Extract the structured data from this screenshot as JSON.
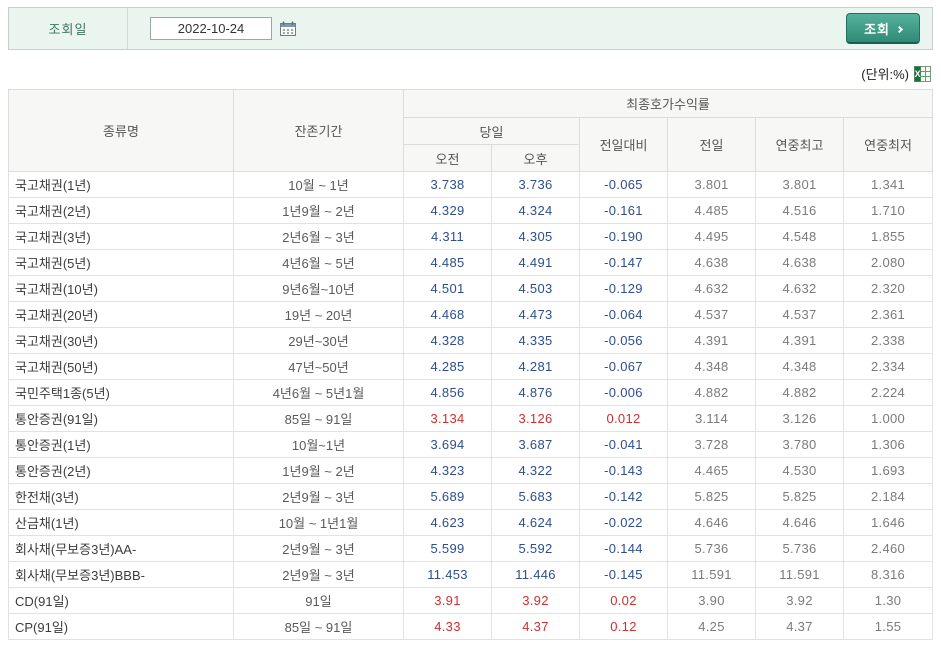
{
  "query_bar": {
    "label": "조회일",
    "date_value": "2022-10-24",
    "search_button": "조회"
  },
  "unit_label": "(단위:%)",
  "colors": {
    "accent_teal": "#2f8b76",
    "negative_blue": "#2e4e8f",
    "positive_red": "#cc2f2f",
    "bar_bg": "#eaf5f0"
  },
  "table": {
    "headers": {
      "col_type": "종류명",
      "col_period": "잔존기간",
      "group_yield": "최종호가수익률",
      "group_today": "당일",
      "col_morning": "오전",
      "col_afternoon": "오후",
      "col_change": "전일대비",
      "col_prev": "전일",
      "col_high": "연중최고",
      "col_low": "연중최저"
    },
    "rows": [
      {
        "name": "국고채권(1년)",
        "period": "10월 ~ 1년",
        "am": "3.738",
        "pm": "3.736",
        "change": "-0.065",
        "prev": "3.801",
        "high": "3.801",
        "low": "1.341",
        "up": false
      },
      {
        "name": "국고채권(2년)",
        "period": "1년9월 ~ 2년",
        "am": "4.329",
        "pm": "4.324",
        "change": "-0.161",
        "prev": "4.485",
        "high": "4.516",
        "low": "1.710",
        "up": false
      },
      {
        "name": "국고채권(3년)",
        "period": "2년6월 ~ 3년",
        "am": "4.311",
        "pm": "4.305",
        "change": "-0.190",
        "prev": "4.495",
        "high": "4.548",
        "low": "1.855",
        "up": false
      },
      {
        "name": "국고채권(5년)",
        "period": "4년6월 ~ 5년",
        "am": "4.485",
        "pm": "4.491",
        "change": "-0.147",
        "prev": "4.638",
        "high": "4.638",
        "low": "2.080",
        "up": false
      },
      {
        "name": "국고채권(10년)",
        "period": "9년6월~10년",
        "am": "4.501",
        "pm": "4.503",
        "change": "-0.129",
        "prev": "4.632",
        "high": "4.632",
        "low": "2.320",
        "up": false
      },
      {
        "name": "국고채권(20년)",
        "period": "19년 ~ 20년",
        "am": "4.468",
        "pm": "4.473",
        "change": "-0.064",
        "prev": "4.537",
        "high": "4.537",
        "low": "2.361",
        "up": false
      },
      {
        "name": "국고채권(30년)",
        "period": "29년~30년",
        "am": "4.328",
        "pm": "4.335",
        "change": "-0.056",
        "prev": "4.391",
        "high": "4.391",
        "low": "2.338",
        "up": false
      },
      {
        "name": "국고채권(50년)",
        "period": "47년~50년",
        "am": "4.285",
        "pm": "4.281",
        "change": "-0.067",
        "prev": "4.348",
        "high": "4.348",
        "low": "2.334",
        "up": false
      },
      {
        "name": "국민주택1종(5년)",
        "period": "4년6월 ~ 5년1월",
        "am": "4.856",
        "pm": "4.876",
        "change": "-0.006",
        "prev": "4.882",
        "high": "4.882",
        "low": "2.224",
        "up": false
      },
      {
        "name": "통안증권(91일)",
        "period": "85일 ~ 91일",
        "am": "3.134",
        "pm": "3.126",
        "change": "0.012",
        "prev": "3.114",
        "high": "3.126",
        "low": "1.000",
        "up": true
      },
      {
        "name": "통안증권(1년)",
        "period": "10월~1년",
        "am": "3.694",
        "pm": "3.687",
        "change": "-0.041",
        "prev": "3.728",
        "high": "3.780",
        "low": "1.306",
        "up": false
      },
      {
        "name": "통안증권(2년)",
        "period": "1년9월 ~ 2년",
        "am": "4.323",
        "pm": "4.322",
        "change": "-0.143",
        "prev": "4.465",
        "high": "4.530",
        "low": "1.693",
        "up": false
      },
      {
        "name": "한전채(3년)",
        "period": "2년9월 ~ 3년",
        "am": "5.689",
        "pm": "5.683",
        "change": "-0.142",
        "prev": "5.825",
        "high": "5.825",
        "low": "2.184",
        "up": false
      },
      {
        "name": "산금채(1년)",
        "period": "10월 ~ 1년1월",
        "am": "4.623",
        "pm": "4.624",
        "change": "-0.022",
        "prev": "4.646",
        "high": "4.646",
        "low": "1.646",
        "up": false
      },
      {
        "name": "회사채(무보증3년)AA-",
        "period": "2년9월 ~ 3년",
        "am": "5.599",
        "pm": "5.592",
        "change": "-0.144",
        "prev": "5.736",
        "high": "5.736",
        "low": "2.460",
        "up": false
      },
      {
        "name": "회사채(무보증3년)BBB-",
        "period": "2년9월 ~ 3년",
        "am": "11.453",
        "pm": "11.446",
        "change": "-0.145",
        "prev": "11.591",
        "high": "11.591",
        "low": "8.316",
        "up": false
      },
      {
        "name": "CD(91일)",
        "period": "91일",
        "am": "3.91",
        "pm": "3.92",
        "change": "0.02",
        "prev": "3.90",
        "high": "3.92",
        "low": "1.30",
        "up": true
      },
      {
        "name": "CP(91일)",
        "period": "85일 ~ 91일",
        "am": "4.33",
        "pm": "4.37",
        "change": "0.12",
        "prev": "4.25",
        "high": "4.37",
        "low": "1.55",
        "up": true
      }
    ]
  }
}
